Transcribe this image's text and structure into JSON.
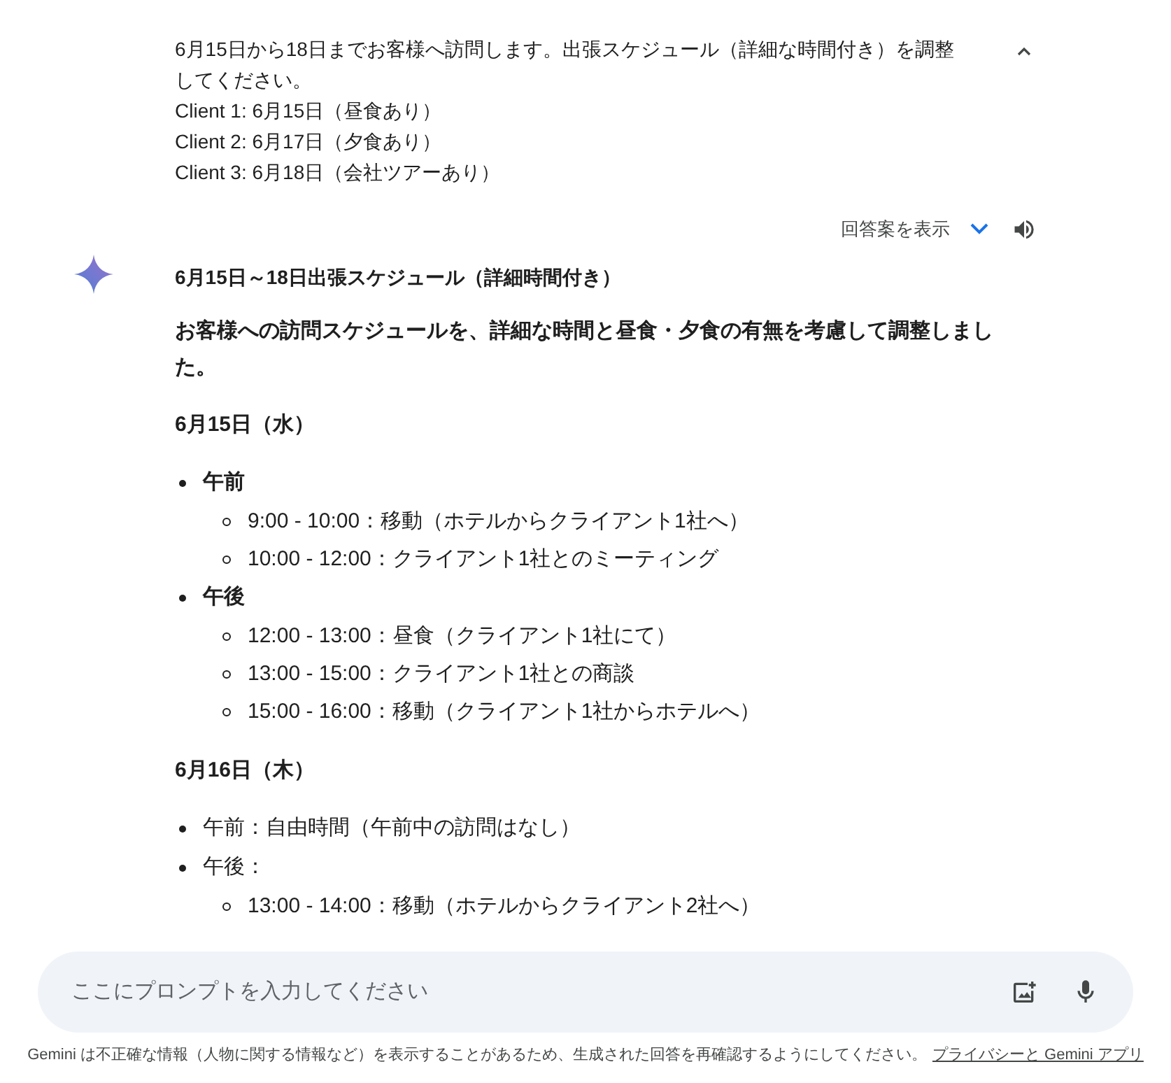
{
  "prompt": {
    "lines": [
      "6月15日から18日までお客様へ訪問します。出張スケジュール（詳細な時間付き）を調整してください。",
      "Client 1: 6月15日（昼食あり）",
      "Client 2: 6月17日（夕食あり）",
      "Client 3: 6月18日（会社ツアーあり）"
    ],
    "expanded": true
  },
  "drafts": {
    "label": "回答案を表示"
  },
  "response": {
    "title": "6月15日～18日出張スケジュール（詳細時間付き）",
    "intro": "お客様への訪問スケジュールを、詳細な時間と昼食・夕食の有無を考慮して調整しました。",
    "days": [
      {
        "heading": "6月15日（水）",
        "items": [
          {
            "label": "午前",
            "bold": true,
            "children": [
              "9:00 - 10:00：移動（ホテルからクライアント1社へ）",
              "10:00 - 12:00：クライアント1社とのミーティング"
            ]
          },
          {
            "label": "午後",
            "bold": true,
            "children": [
              "12:00 - 13:00：昼食（クライアント1社にて）",
              "13:00 - 15:00：クライアント1社との商談",
              "15:00 - 16:00：移動（クライアント1社からホテルへ）"
            ]
          }
        ]
      },
      {
        "heading": "6月16日（木）",
        "items": [
          {
            "label": "午前：自由時間（午前中の訪問はなし）",
            "bold": false
          },
          {
            "label": "午後：",
            "bold": false,
            "children": [
              "13:00 - 14:00：移動（ホテルからクライアント2社へ）"
            ]
          }
        ]
      }
    ]
  },
  "input": {
    "placeholder": "ここにプロンプトを入力してください"
  },
  "footer": {
    "text": "Gemini は不正確な情報（人物に関する情報など）を表示することがあるため、生成された回答を再確認するようにしてください。",
    "link": "プライバシーと Gemini アプリ"
  }
}
